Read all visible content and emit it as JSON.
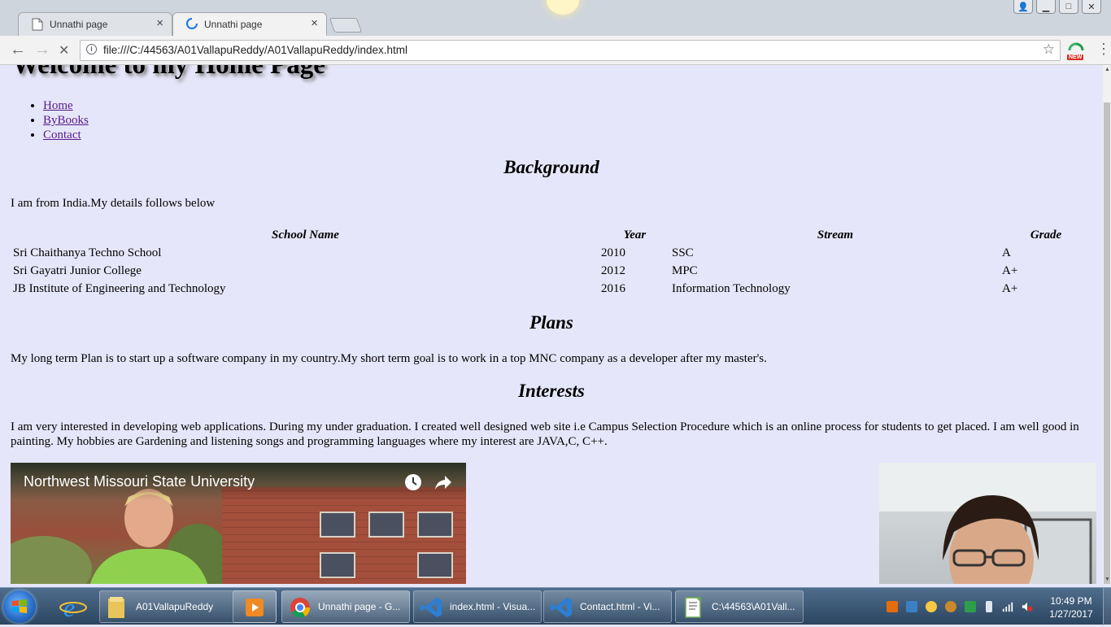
{
  "browser": {
    "tabs": [
      {
        "title": "Unnathi page",
        "close": "×"
      },
      {
        "title": "Unnathi page",
        "close": "×"
      }
    ],
    "url": "file:///C:/44563/A01VallapuReddy/A01VallapuReddy/index.html",
    "info_glyph": "i",
    "ext_badge": "NEW",
    "icons": {
      "back": "←",
      "forward": "→",
      "stop": "✕",
      "star": "☆",
      "menu": "⋮",
      "minimize": "▁",
      "maximize": "□",
      "close": "✕",
      "profile": "👤"
    }
  },
  "page": {
    "title": "Welcome to my Home Page",
    "nav": [
      "Home",
      "ByBooks",
      "Contact"
    ],
    "background_heading": "Background",
    "background_text": "I am from India.My details follows below",
    "table": {
      "headers": [
        "School Name",
        "Year",
        "Stream",
        "Grade"
      ],
      "rows": [
        [
          "Sri Chaithanya Techno School",
          "2010",
          "SSC",
          "A"
        ],
        [
          "Sri Gayatri Junior College",
          "2012",
          "MPC",
          "A+"
        ],
        [
          "JB Institute of Engineering and Technology",
          "2016",
          "Information Technology",
          "A+"
        ]
      ]
    },
    "plans_heading": "Plans",
    "plans_text": "My long term Plan is to start up a software company in my country.My short term goal is to work in a top MNC company as a developer after my master's.",
    "interests_heading": "Interests",
    "interests_text": "I am very interested in developing web applications. During my under graduation. I created well designed web site i.e Campus Selection Procedure which is an online process for students to get placed. I am well good in painting. My hobbies are Gardening and listening songs and programming languages where my interest are JAVA,C, C++.",
    "video_title": "Northwest Missouri State University"
  },
  "taskbar": {
    "items": [
      {
        "label": "A01VallapuReddy"
      },
      {
        "label": ""
      },
      {
        "label": "Unnathi page - G..."
      },
      {
        "label": "index.html - Visua..."
      },
      {
        "label": "Contact.html - Vi..."
      },
      {
        "label": "C:\\44563\\A01Vall..."
      }
    ],
    "clock_time": "10:49 PM",
    "clock_date": "1/27/2017"
  },
  "colors": {
    "page_bg": "#e6e6fa",
    "link": "#551a8b",
    "chrome_tabstrip": "#cfd5dd",
    "taskbar": "#2b4560"
  }
}
